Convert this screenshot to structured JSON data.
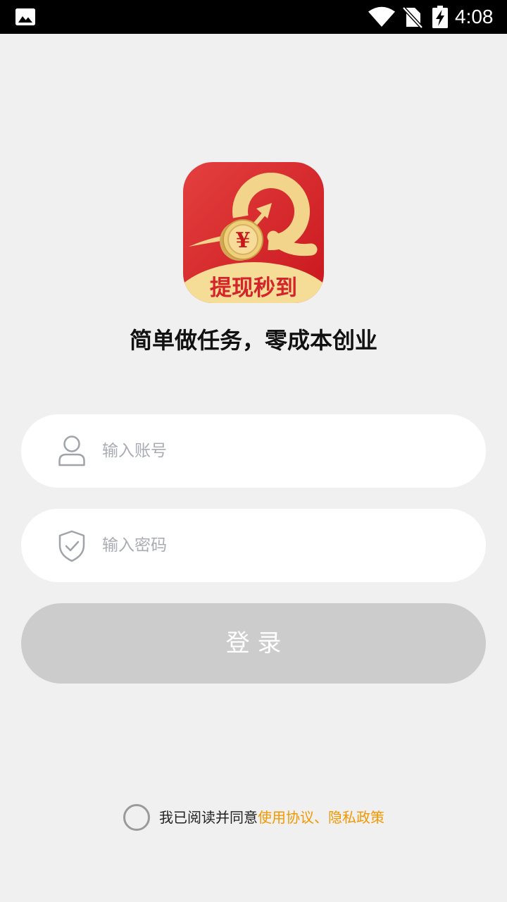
{
  "status_bar": {
    "time": "4:08",
    "icons": [
      "image-icon",
      "wifi-icon",
      "no-sim-icon",
      "battery-charging-icon"
    ]
  },
  "logo": {
    "caption": "提现秒到",
    "coin_symbol": "¥",
    "icon": "app-logo"
  },
  "tagline": "简单做任务，零成本创业",
  "login_form": {
    "account": {
      "placeholder": "输入账号",
      "value": "",
      "icon": "user-icon"
    },
    "password": {
      "placeholder": "输入密码",
      "value": "",
      "icon": "shield-check-icon"
    },
    "submit_label": "登 录"
  },
  "agreement": {
    "checked": false,
    "prefix": "我已阅读并同意",
    "link": "使用协议、隐私政策"
  },
  "colors": {
    "background": "#f0f0f0",
    "status_bar": "#000000",
    "button_disabled": "#cccccc",
    "link": "#f39800",
    "placeholder": "#a9adb3",
    "brand_red": "#d7262c",
    "brand_gold": "#f5dd97"
  }
}
